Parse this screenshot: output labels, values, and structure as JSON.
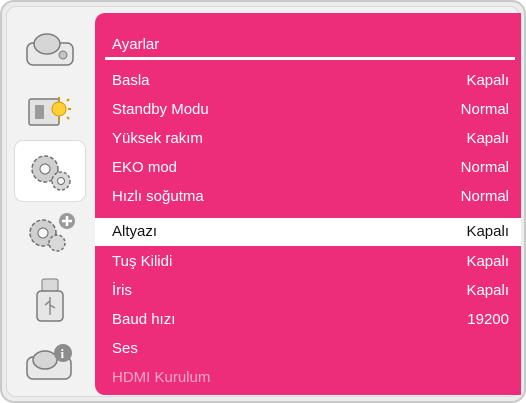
{
  "sidebar": {
    "items": [
      {
        "icon": "projector-icon"
      },
      {
        "icon": "picture-settings-icon"
      },
      {
        "icon": "settings-gears-icon"
      },
      {
        "icon": "expanded-settings-icon"
      },
      {
        "icon": "usb-icon"
      },
      {
        "icon": "info-icon"
      }
    ]
  },
  "panel": {
    "title": "Ayarlar",
    "rows": [
      {
        "label": "Basla",
        "value": "Kapalı"
      },
      {
        "label": "Standby Modu",
        "value": "Normal"
      },
      {
        "label": "Yüksek rakım",
        "value": "Kapalı"
      },
      {
        "label": "EKO mod",
        "value": "Normal"
      },
      {
        "label": "Hızlı soğutma",
        "value": "Normal"
      },
      {
        "label": "Altyazı",
        "value": "Kapalı"
      },
      {
        "label": "Tuş Kilidi",
        "value": "Kapalı"
      },
      {
        "label": "İris",
        "value": "Kapalı"
      },
      {
        "label": "Baud hızı",
        "value": "19200"
      },
      {
        "label": "Ses",
        "value": ""
      },
      {
        "label": "HDMI Kurulum",
        "value": ""
      }
    ]
  },
  "colors": {
    "menu_accent": "#ee2d7a",
    "selected_row": "#ffffff",
    "disabled_text": "#f7a9c6"
  }
}
